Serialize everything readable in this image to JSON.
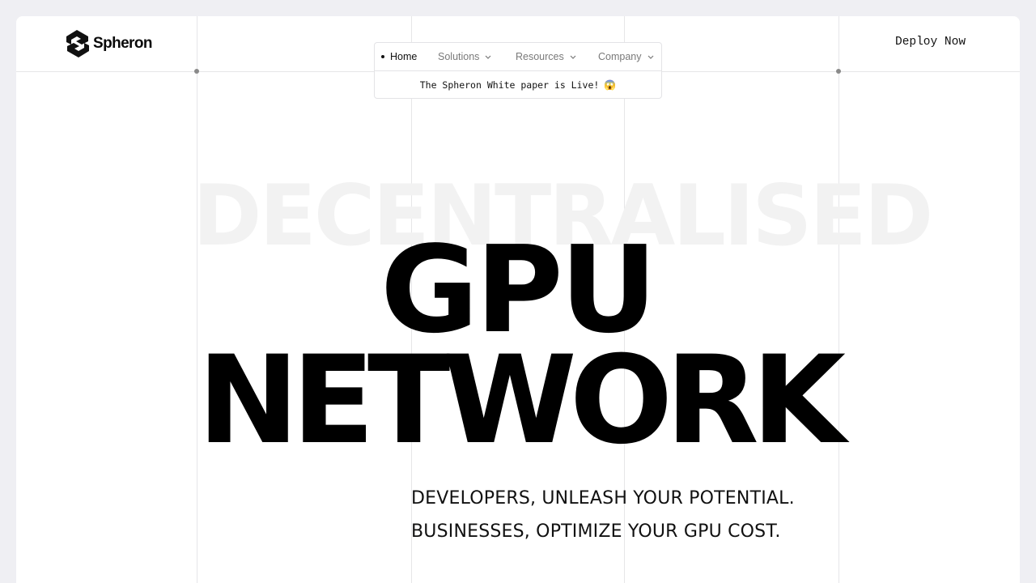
{
  "brand": {
    "name": "Spheron",
    "icon": "spheron-logo-icon"
  },
  "nav": {
    "items": [
      {
        "label": "Home",
        "active": true,
        "dropdown": false
      },
      {
        "label": "Solutions",
        "active": false,
        "dropdown": true
      },
      {
        "label": "Resources",
        "active": false,
        "dropdown": true
      },
      {
        "label": "Company",
        "active": false,
        "dropdown": true
      }
    ],
    "banner": {
      "text": "The Spheron White paper is Live!",
      "emoji": "😱"
    }
  },
  "header": {
    "cta": "Deploy Now"
  },
  "hero": {
    "background_word": "DECENTRALISED",
    "line1": "GPU",
    "line2": "NETWORK",
    "tagline1": "DEVELOPERS, UNLEASH YOUR POTENTIAL.",
    "tagline2": "BUSINESSES, OPTIMIZE YOUR GPU COST."
  },
  "colors": {
    "page_background": "#efeff3",
    "surface": "#ffffff",
    "text": "#0a0a0a",
    "muted_text": "#7a7a7a",
    "grid_line": "#e6e6e8",
    "watermark": "#f2f2f2"
  }
}
